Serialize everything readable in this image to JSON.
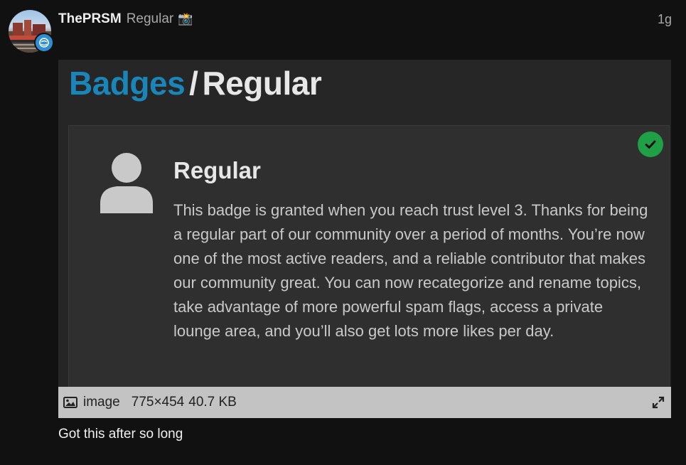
{
  "post": {
    "username": "ThePRSM",
    "user_title": "Regular",
    "user_title_icon": "camera-flash-emoji",
    "date": "1g",
    "body_text": "Got this after so long"
  },
  "image": {
    "breadcrumb_link": "Badges",
    "breadcrumb_separator": "/",
    "breadcrumb_current": "Regular",
    "badge_title": "Regular",
    "badge_description": "This badge is granted when you reach trust level 3. Thanks for being a regular part of our community over a period of months. You’re now one of the most active readers, and a reliable contributor that makes our community great. You can now recategorize and rename topics, take advantage of more powerful spam flags, access a private lounge area, and you’ll also get lots more likes per day.",
    "granted_icon": "check-circle-icon",
    "badge_icon": "user-icon"
  },
  "image_meta": {
    "filename": "image",
    "dimensions": "775×454",
    "filesize": "40.7 KB"
  },
  "colors": {
    "background": "#111111",
    "link_blue": "#1a85b9",
    "granted_green": "#1fa047",
    "meta_bar": "#c3c3c3"
  }
}
